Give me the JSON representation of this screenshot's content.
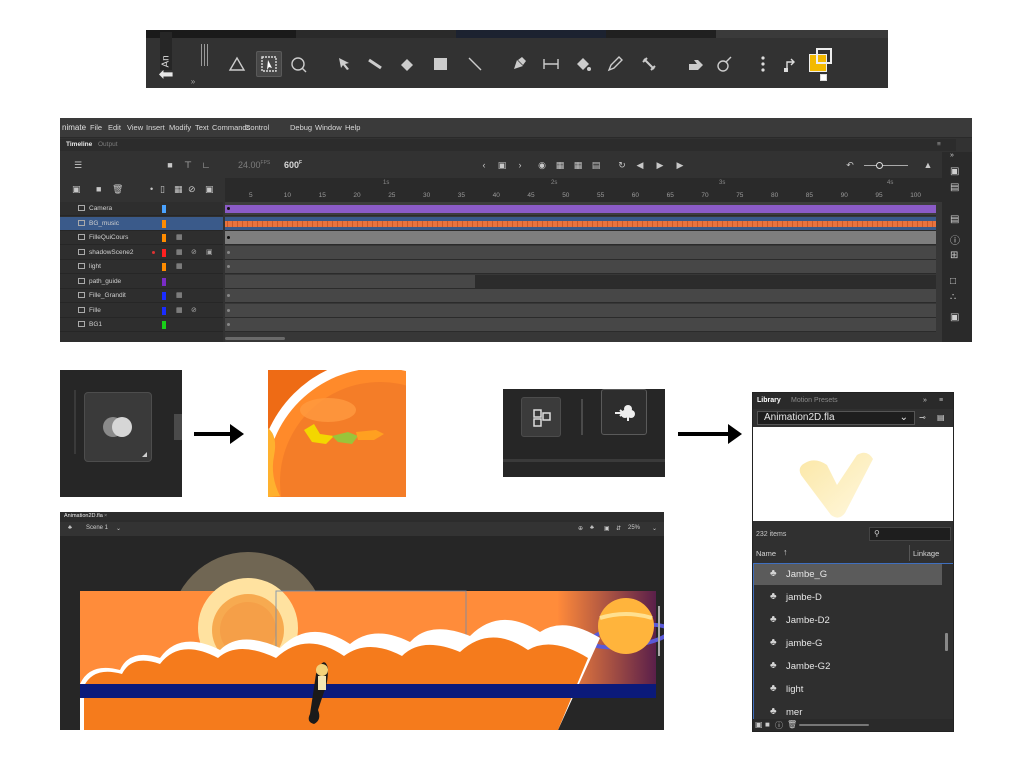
{
  "toolbar": {
    "doc_tab": "An",
    "back_glyph": "⬅",
    "more_glyph": "»",
    "tools": [
      {
        "name": "lasso-icon"
      },
      {
        "name": "free-transform-icon",
        "selected": true
      },
      {
        "name": "gradient-transform-icon"
      },
      {
        "name": "subselect-icon"
      },
      {
        "name": "line-selection-icon"
      },
      {
        "name": "eraser-icon"
      },
      {
        "name": "rectangle-icon"
      },
      {
        "name": "line-icon"
      },
      {
        "name": "pen-icon"
      },
      {
        "name": "width-tool-icon"
      },
      {
        "name": "paint-bucket-icon"
      },
      {
        "name": "pencil-icon"
      },
      {
        "name": "bone-icon"
      },
      {
        "name": "hand-icon"
      },
      {
        "name": "rotate-icon"
      },
      {
        "name": "more-tools-icon"
      },
      {
        "name": "swap-colors-icon"
      }
    ],
    "fill_color": "#f3b900"
  },
  "timeline_window": {
    "app_name": "nimate",
    "menu": [
      "File",
      "Edit",
      "View",
      "Insert",
      "Modify",
      "Text",
      "Commands",
      "Control",
      "Debug",
      "Window",
      "Help"
    ],
    "tabs": {
      "timeline": "Timeline",
      "output": "Output"
    },
    "fps_value": "24.00",
    "fps_unit": "FPS",
    "frame_value": "600",
    "frame_unit": "F",
    "seconds": [
      "1s",
      "2s",
      "3s",
      "4s"
    ],
    "frame_numbers": [
      "5",
      "10",
      "15",
      "20",
      "25",
      "30",
      "35",
      "40",
      "45",
      "50",
      "55",
      "60",
      "65",
      "70",
      "75",
      "80",
      "85",
      "90",
      "95",
      "100"
    ],
    "layers": [
      {
        "name": "Camera",
        "color": "#4aa3ff",
        "selected": false,
        "cam": false,
        "eye": false,
        "lock": false,
        "track": "purple"
      },
      {
        "name": "BG_music",
        "color": "#ff8c00",
        "selected": true,
        "cam": false,
        "eye": false,
        "lock": false,
        "track": "audio"
      },
      {
        "name": "FilleQuiCours",
        "color": "#ff8c00",
        "selected": false,
        "cam": true,
        "eye": false,
        "lock": false,
        "track": "light"
      },
      {
        "name": "shadowScene2",
        "color": "#ff2020",
        "selected": false,
        "cam": true,
        "eye": true,
        "lock": true,
        "red_dot": true,
        "track": "dark"
      },
      {
        "name": "light",
        "color": "#ff8c00",
        "selected": false,
        "cam": true,
        "eye": false,
        "lock": false,
        "track": "dark"
      },
      {
        "name": "path_guide",
        "color": "#7a2cc6",
        "selected": false,
        "cam": false,
        "eye": false,
        "lock": false,
        "track": "keys"
      },
      {
        "name": "Fille_Grandit",
        "color": "#1a2cff",
        "selected": false,
        "cam": true,
        "eye": false,
        "lock": false,
        "track": "dark"
      },
      {
        "name": "Fille",
        "color": "#1a2cff",
        "selected": false,
        "cam": true,
        "eye": true,
        "lock": false,
        "track": "dark"
      },
      {
        "name": "BG1",
        "color": "#18d018",
        "selected": false,
        "cam": false,
        "eye": false,
        "lock": false,
        "track": "dark"
      }
    ]
  },
  "stage": {
    "doc_tab": "Animation2D.fla",
    "scene": "Scene 1",
    "zoom": "25%"
  },
  "library": {
    "tab_library": "Library",
    "tab_presets": "Motion Presets",
    "file": "Animation2D.fla",
    "count": "232 items",
    "col_name": "Name",
    "col_linkage": "Linkage",
    "items": [
      {
        "name": "Jambe_G",
        "selected": true
      },
      {
        "name": "jambe-D",
        "selected": false
      },
      {
        "name": "Jambe-D2",
        "selected": false
      },
      {
        "name": "jambe-G",
        "selected": false
      },
      {
        "name": "Jambe-G2",
        "selected": false
      },
      {
        "name": "light",
        "selected": false
      },
      {
        "name": "mer",
        "selected": false
      }
    ]
  }
}
